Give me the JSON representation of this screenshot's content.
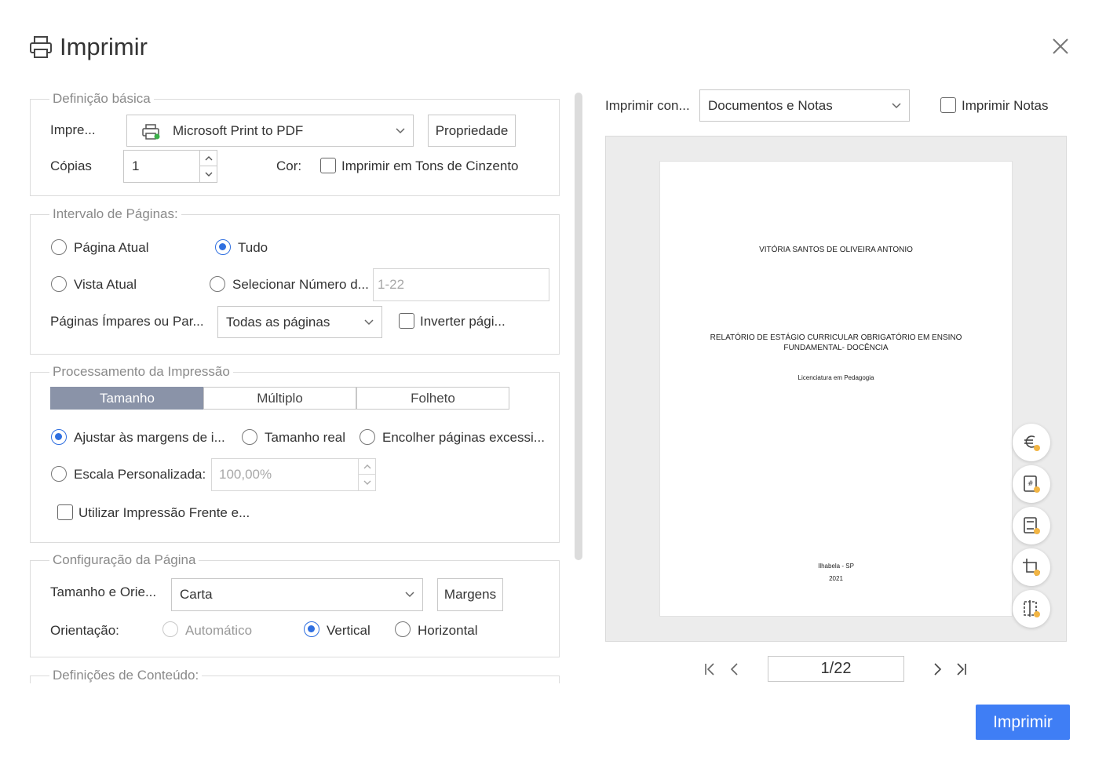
{
  "dialog": {
    "title": "Imprimir",
    "close_icon": "close-icon"
  },
  "basic": {
    "legend": "Definição básica",
    "printer_label": "Impre...",
    "printer_value": "Microsoft Print to PDF",
    "properties_button": "Propriedade",
    "copies_label": "Cópias",
    "copies_value": "1",
    "color_label": "Cor:",
    "grayscale_label": "Imprimir em Tons de Cinzento",
    "grayscale_checked": false
  },
  "range": {
    "legend": "Intervalo de Páginas:",
    "current_page": "Página Atual",
    "all": "Tudo",
    "current_view": "Vista Atual",
    "select_number": "Selecionar Número d...",
    "pages_placeholder": "1-22",
    "odd_even_label": "Páginas Ímpares ou Par...",
    "odd_even_value": "Todas as páginas",
    "reverse_label": "Inverter pági...",
    "selected": "all"
  },
  "processing": {
    "legend": "Processamento da Impressão",
    "tabs": [
      "Tamanho",
      "Múltiplo",
      "Folheto"
    ],
    "active_tab": "Tamanho",
    "fit_margins": "Ajustar às margens de i...",
    "actual_size": "Tamanho real",
    "shrink_pages": "Encolher páginas excessi...",
    "custom_scale": "Escala Personalizada:",
    "scale_placeholder": "100,00%",
    "duplex": "Utilizar Impressão Frente e..."
  },
  "page_setup": {
    "legend": "Configuração da Página",
    "size_label": "Tamanho e Orie...",
    "size_value": "Carta",
    "margins_button": "Margens",
    "orientation_label": "Orientação:",
    "auto": "Automático",
    "vertical": "Vertical",
    "horizontal": "Horizontal",
    "selected": "vertical"
  },
  "content": {
    "legend": "Definições de Conteúdo:"
  },
  "preview": {
    "print_with_label": "Imprimir con...",
    "print_with_value": "Documentos e Notas",
    "print_notes_label": "Imprimir Notas",
    "page_lines": {
      "author": "VITÓRIA SANTOS DE OLIVEIRA ANTONIO",
      "title_line1": "RELATÓRIO DE ESTÁGIO CURRICULAR OBRIGATÓRIO EM ENSINO",
      "title_line2": "FUNDAMENTAL- DOCÊNCIA",
      "course": "Licenciatura em Pedagogia",
      "city": "Ilhabela - SP",
      "year": "2021"
    },
    "page_indicator": "1/22",
    "tools": [
      "currency-icon",
      "page-number-icon",
      "header-footer-icon",
      "crop-icon",
      "split-icon"
    ]
  },
  "actions": {
    "print_button": "Imprimir"
  },
  "colors": {
    "accent": "#3f7ef5",
    "radio_selected": "#2f6fe0",
    "tab_active": "#8a93a8"
  }
}
